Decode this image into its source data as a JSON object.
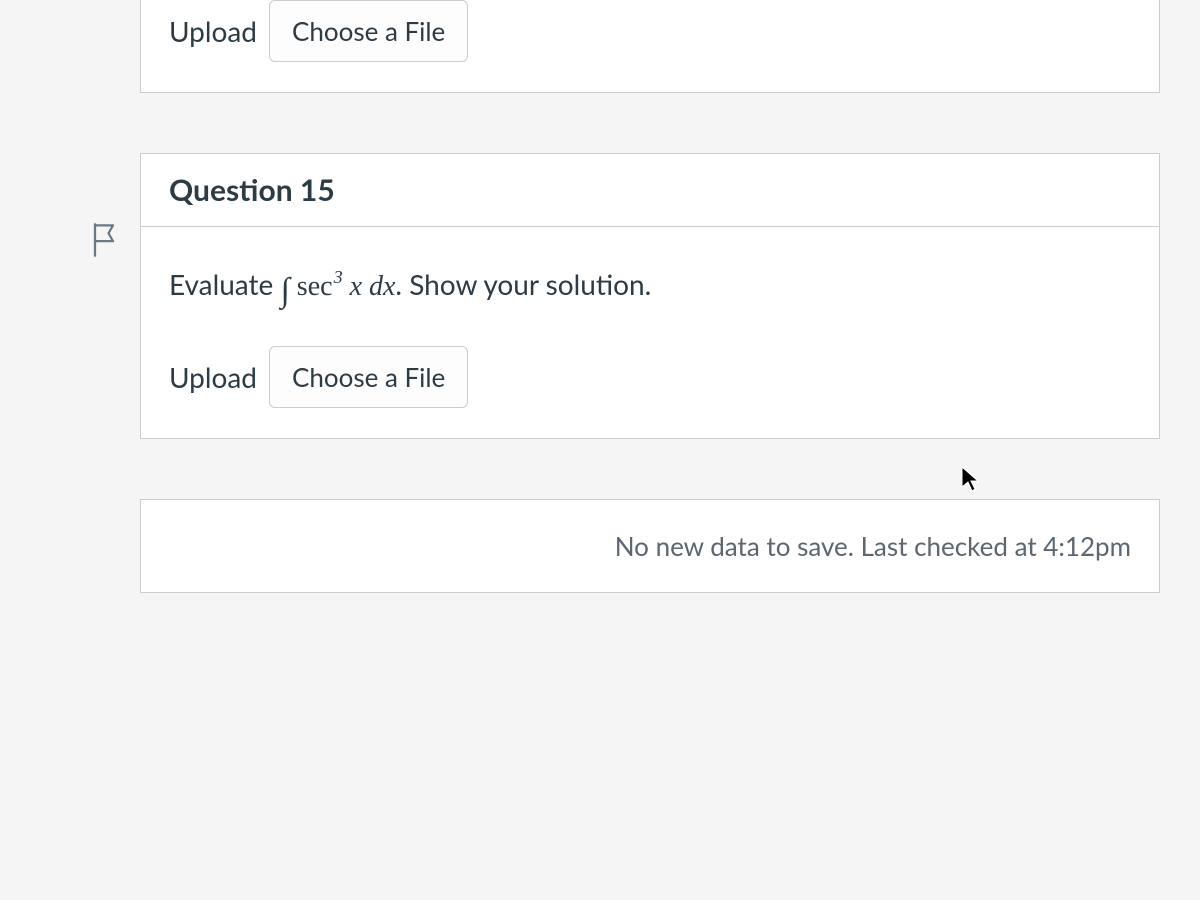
{
  "prev_question": {
    "upload_label": "Upload",
    "choose_file_label": "Choose a File"
  },
  "question": {
    "title": "Question 15",
    "prompt_prefix": "Evaluate ",
    "prompt_integral": "∫",
    "prompt_func": "sec",
    "prompt_exp": "3",
    "prompt_var": " x dx",
    "prompt_suffix": ".  Show your solution.",
    "upload_label": "Upload",
    "choose_file_label": "Choose a File"
  },
  "footer": {
    "save_status": "No new data to save. Last checked at 4:12pm"
  }
}
